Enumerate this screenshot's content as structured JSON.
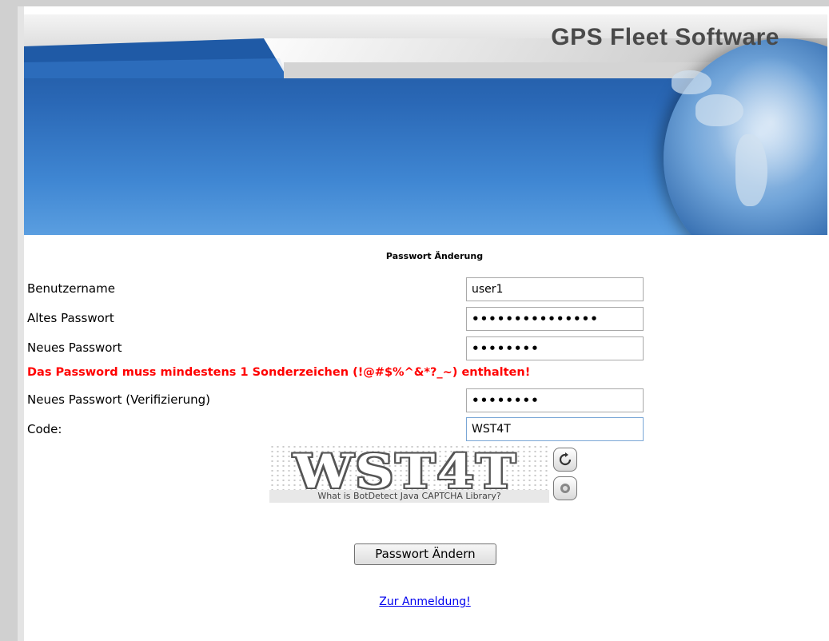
{
  "header": {
    "brand": "GPS Fleet Software"
  },
  "form": {
    "title": "Passwort Änderung",
    "fields": [
      {
        "label": "Benutzername",
        "value": "user1"
      },
      {
        "label": "Altes Passwort",
        "value": "•••••••••••••••"
      },
      {
        "label": "Neues Passwort",
        "value": "••••••••"
      },
      {
        "label": "Neues Passwort (Verifizierung)",
        "value": "••••••••"
      },
      {
        "label": "Code:",
        "value": "WST4T"
      }
    ],
    "error": "Das Password muss mindestens 1 Sonderzeichen (!@#$%^&*?_~) enthalten!",
    "captcha": {
      "image_text": "WST4T",
      "footer": "What is BotDetect Java CAPTCHA Library?",
      "reload_icon": "reload-icon",
      "sound_icon": "sound-icon"
    },
    "submit_label": "Passwort Ändern",
    "login_link": "Zur Anmeldung!"
  }
}
